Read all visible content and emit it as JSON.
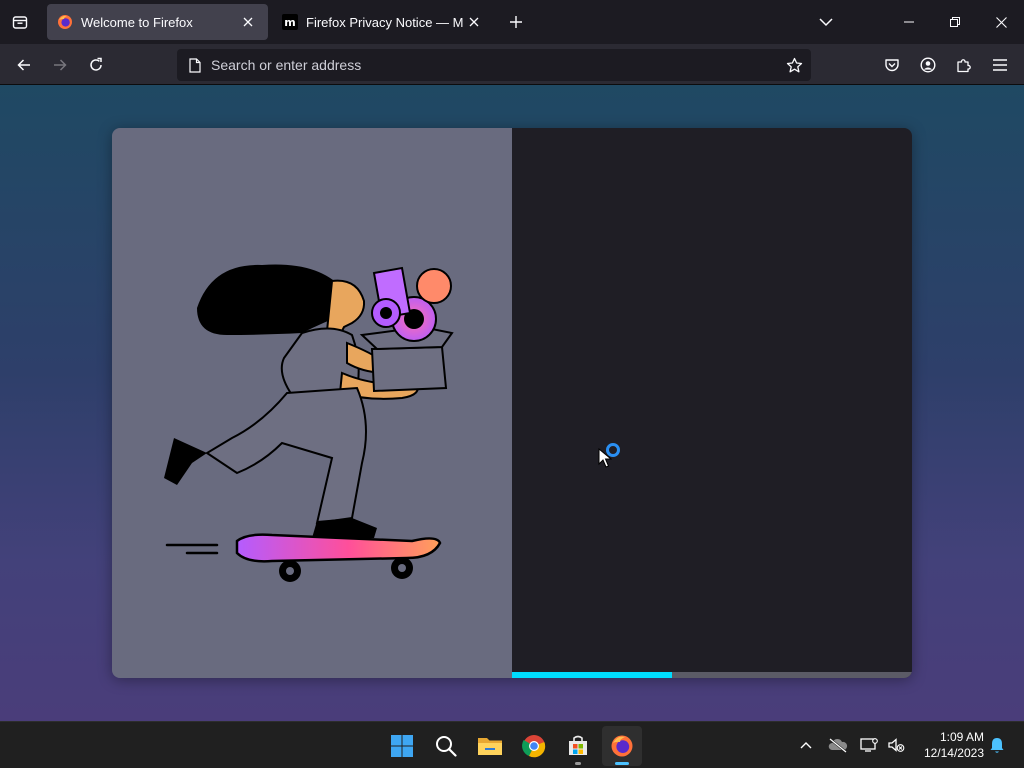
{
  "tabs": [
    {
      "title": "Welcome to Firefox",
      "active": true
    },
    {
      "title": "Firefox Privacy Notice — Mozilla",
      "active": false
    }
  ],
  "navbar": {
    "url_placeholder": "Search or enter address"
  },
  "onboarding": {
    "loading_progress": 0.4
  },
  "taskbar": {
    "time": "1:09 AM",
    "date": "12/14/2023"
  },
  "colors": {
    "accent": "#00ddff",
    "spinner": "#2a8ff2",
    "windows_accent": "#4cc2ff"
  }
}
